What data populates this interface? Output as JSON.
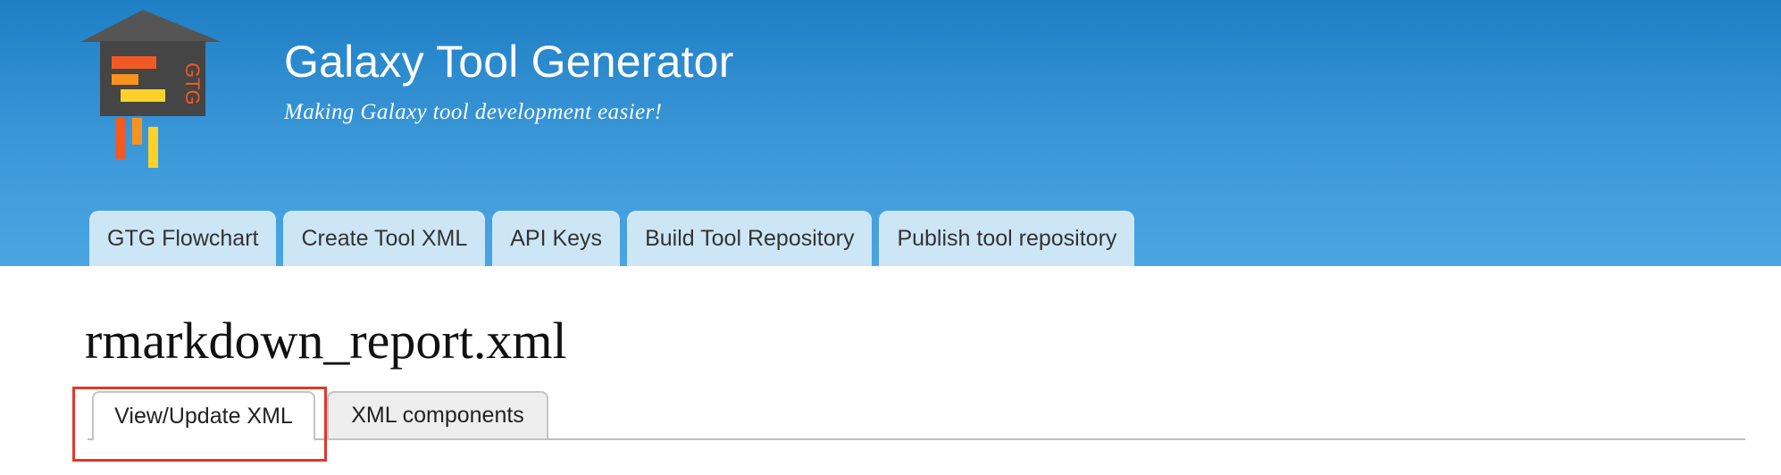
{
  "header": {
    "logo_icon": "gtg-logo-icon",
    "logo_text": "GTG",
    "site_title": "Galaxy Tool Generator",
    "site_slogan": "Making Galaxy tool development easier!",
    "colors": {
      "header_top": "#1f7fc5",
      "header_bottom": "#4aa5e2",
      "tab_background": "#cde6f5"
    }
  },
  "main_tabs": [
    {
      "label": "GTG Flowchart"
    },
    {
      "label": "Create Tool XML"
    },
    {
      "label": "API Keys"
    },
    {
      "label": "Build Tool Repository"
    },
    {
      "label": "Publish tool repository"
    }
  ],
  "page": {
    "title": "rmarkdown_report.xml"
  },
  "sub_tabs": [
    {
      "label": "View/Update XML",
      "active": true
    },
    {
      "label": "XML components",
      "active": false
    }
  ],
  "highlight": {
    "color": "#e0382c",
    "target": "View/Update XML"
  }
}
